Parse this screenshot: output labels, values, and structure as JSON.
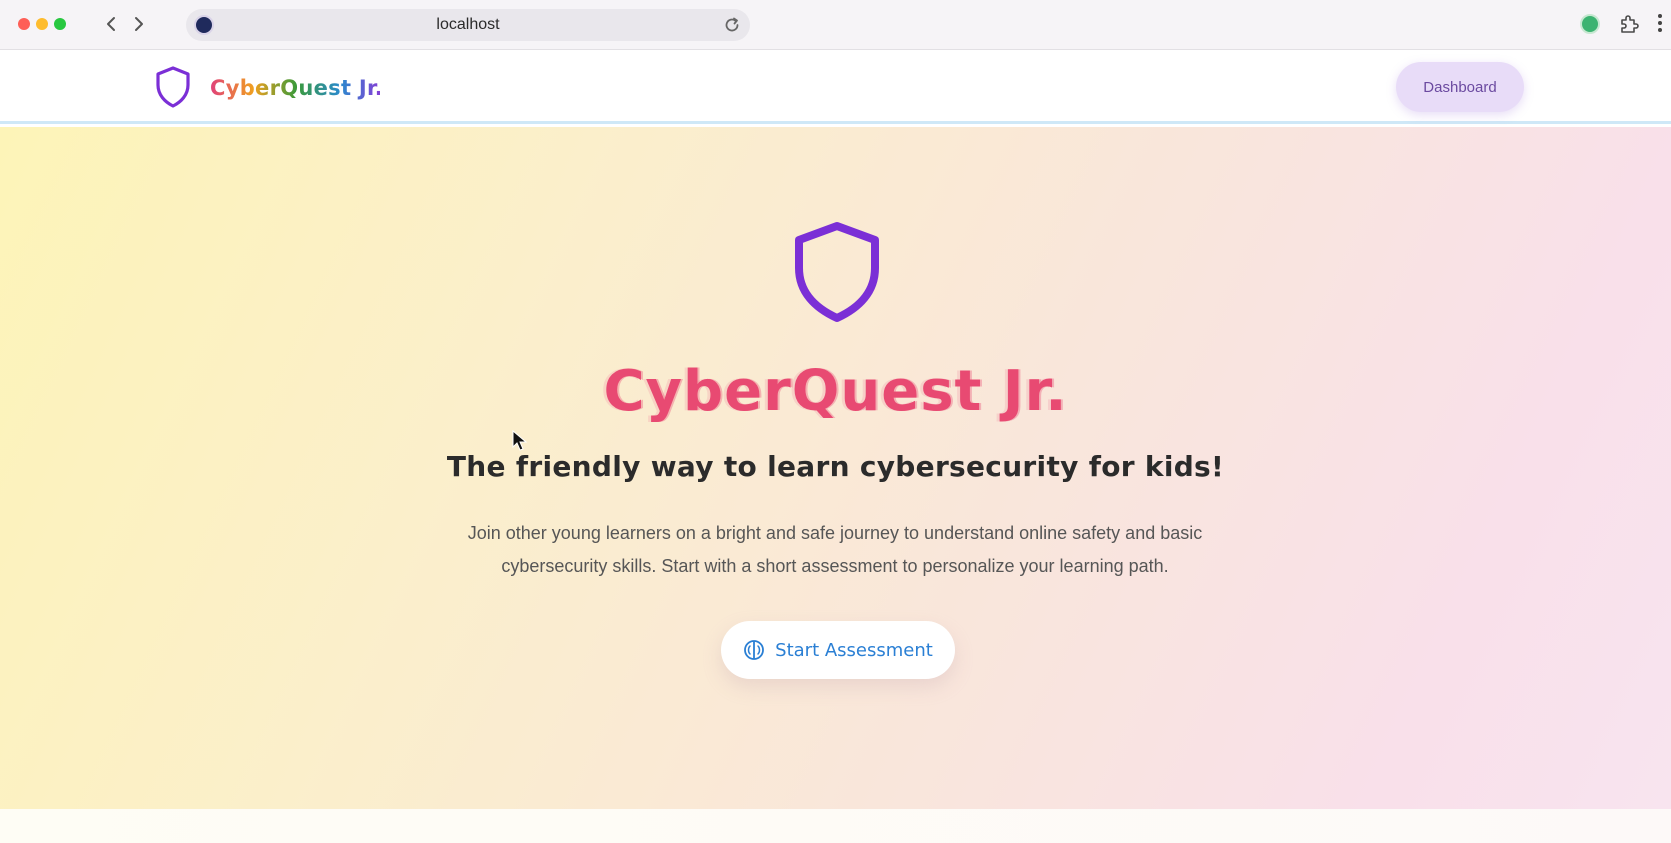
{
  "browser": {
    "url": "localhost"
  },
  "header": {
    "brand_name": "CyberQuest Jr.",
    "dashboard_label": "Dashboard"
  },
  "hero": {
    "title": "CyberQuest Jr.",
    "subtitle": "The friendly way to learn cybersecurity for kids!",
    "description_line1": "Join other young learners on a bright and safe journey to understand online safety and basic",
    "description_line2": "cybersecurity skills. Start with a short assessment to personalize your learning path.",
    "cta_label": "Start Assessment"
  },
  "colors": {
    "accent_purple": "#7b2fd6",
    "title_pink": "#e84a72",
    "cta_blue": "#2a7fd4",
    "dashboard_bg": "#e8dcf8"
  },
  "icons": {
    "brand": "shield-icon",
    "hero": "shield-icon",
    "cta": "brain-icon",
    "back": "chevron-left-icon",
    "forward": "chevron-right-icon",
    "reload": "reload-icon",
    "extensions": "puzzle-icon",
    "menu": "kebab-menu-icon"
  }
}
